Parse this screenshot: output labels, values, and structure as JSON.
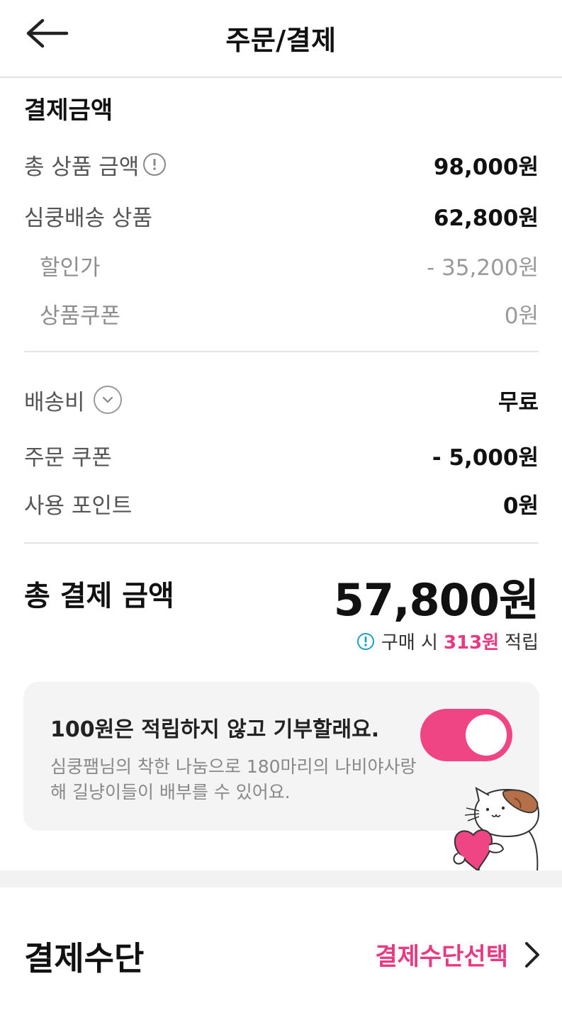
{
  "header": {
    "title": "주문/결제",
    "back_icon": "arrow-left-icon"
  },
  "summary": {
    "section_title": "결제금액",
    "rows": [
      {
        "label": "총 상품 금액",
        "value": "98,000원"
      },
      {
        "label": "심쿵배송 상품",
        "value": "62,800원"
      },
      {
        "label": "할인가",
        "value": "- 35,200원"
      },
      {
        "label": "상품쿠폰",
        "value": "0원"
      },
      {
        "label": "배송비",
        "value": "무료"
      },
      {
        "label": "주문 쿠폰",
        "value": "- 5,000원"
      },
      {
        "label": "사용 포인트",
        "value": "0원"
      }
    ]
  },
  "total": {
    "label": "총 결제 금액",
    "value": "57,800원",
    "points_prefix": "구매 시",
    "points_amount": "313원",
    "points_suffix": "적립"
  },
  "donation": {
    "title": "100원은 적립하지 않고 기부할래요.",
    "description": "심쿵팸님의 착한 나눔으로 180마리의 나비야사랑해 길냥이들이 배부를 수 있어요.",
    "toggle_on": true,
    "toggle_color": "#ef4584"
  },
  "payment": {
    "title": "결제수단",
    "select_label": "결제수단선택"
  },
  "colors": {
    "accent": "#e83a82",
    "info": "#1e9fc4",
    "card_bg": "#f4f4f4"
  }
}
